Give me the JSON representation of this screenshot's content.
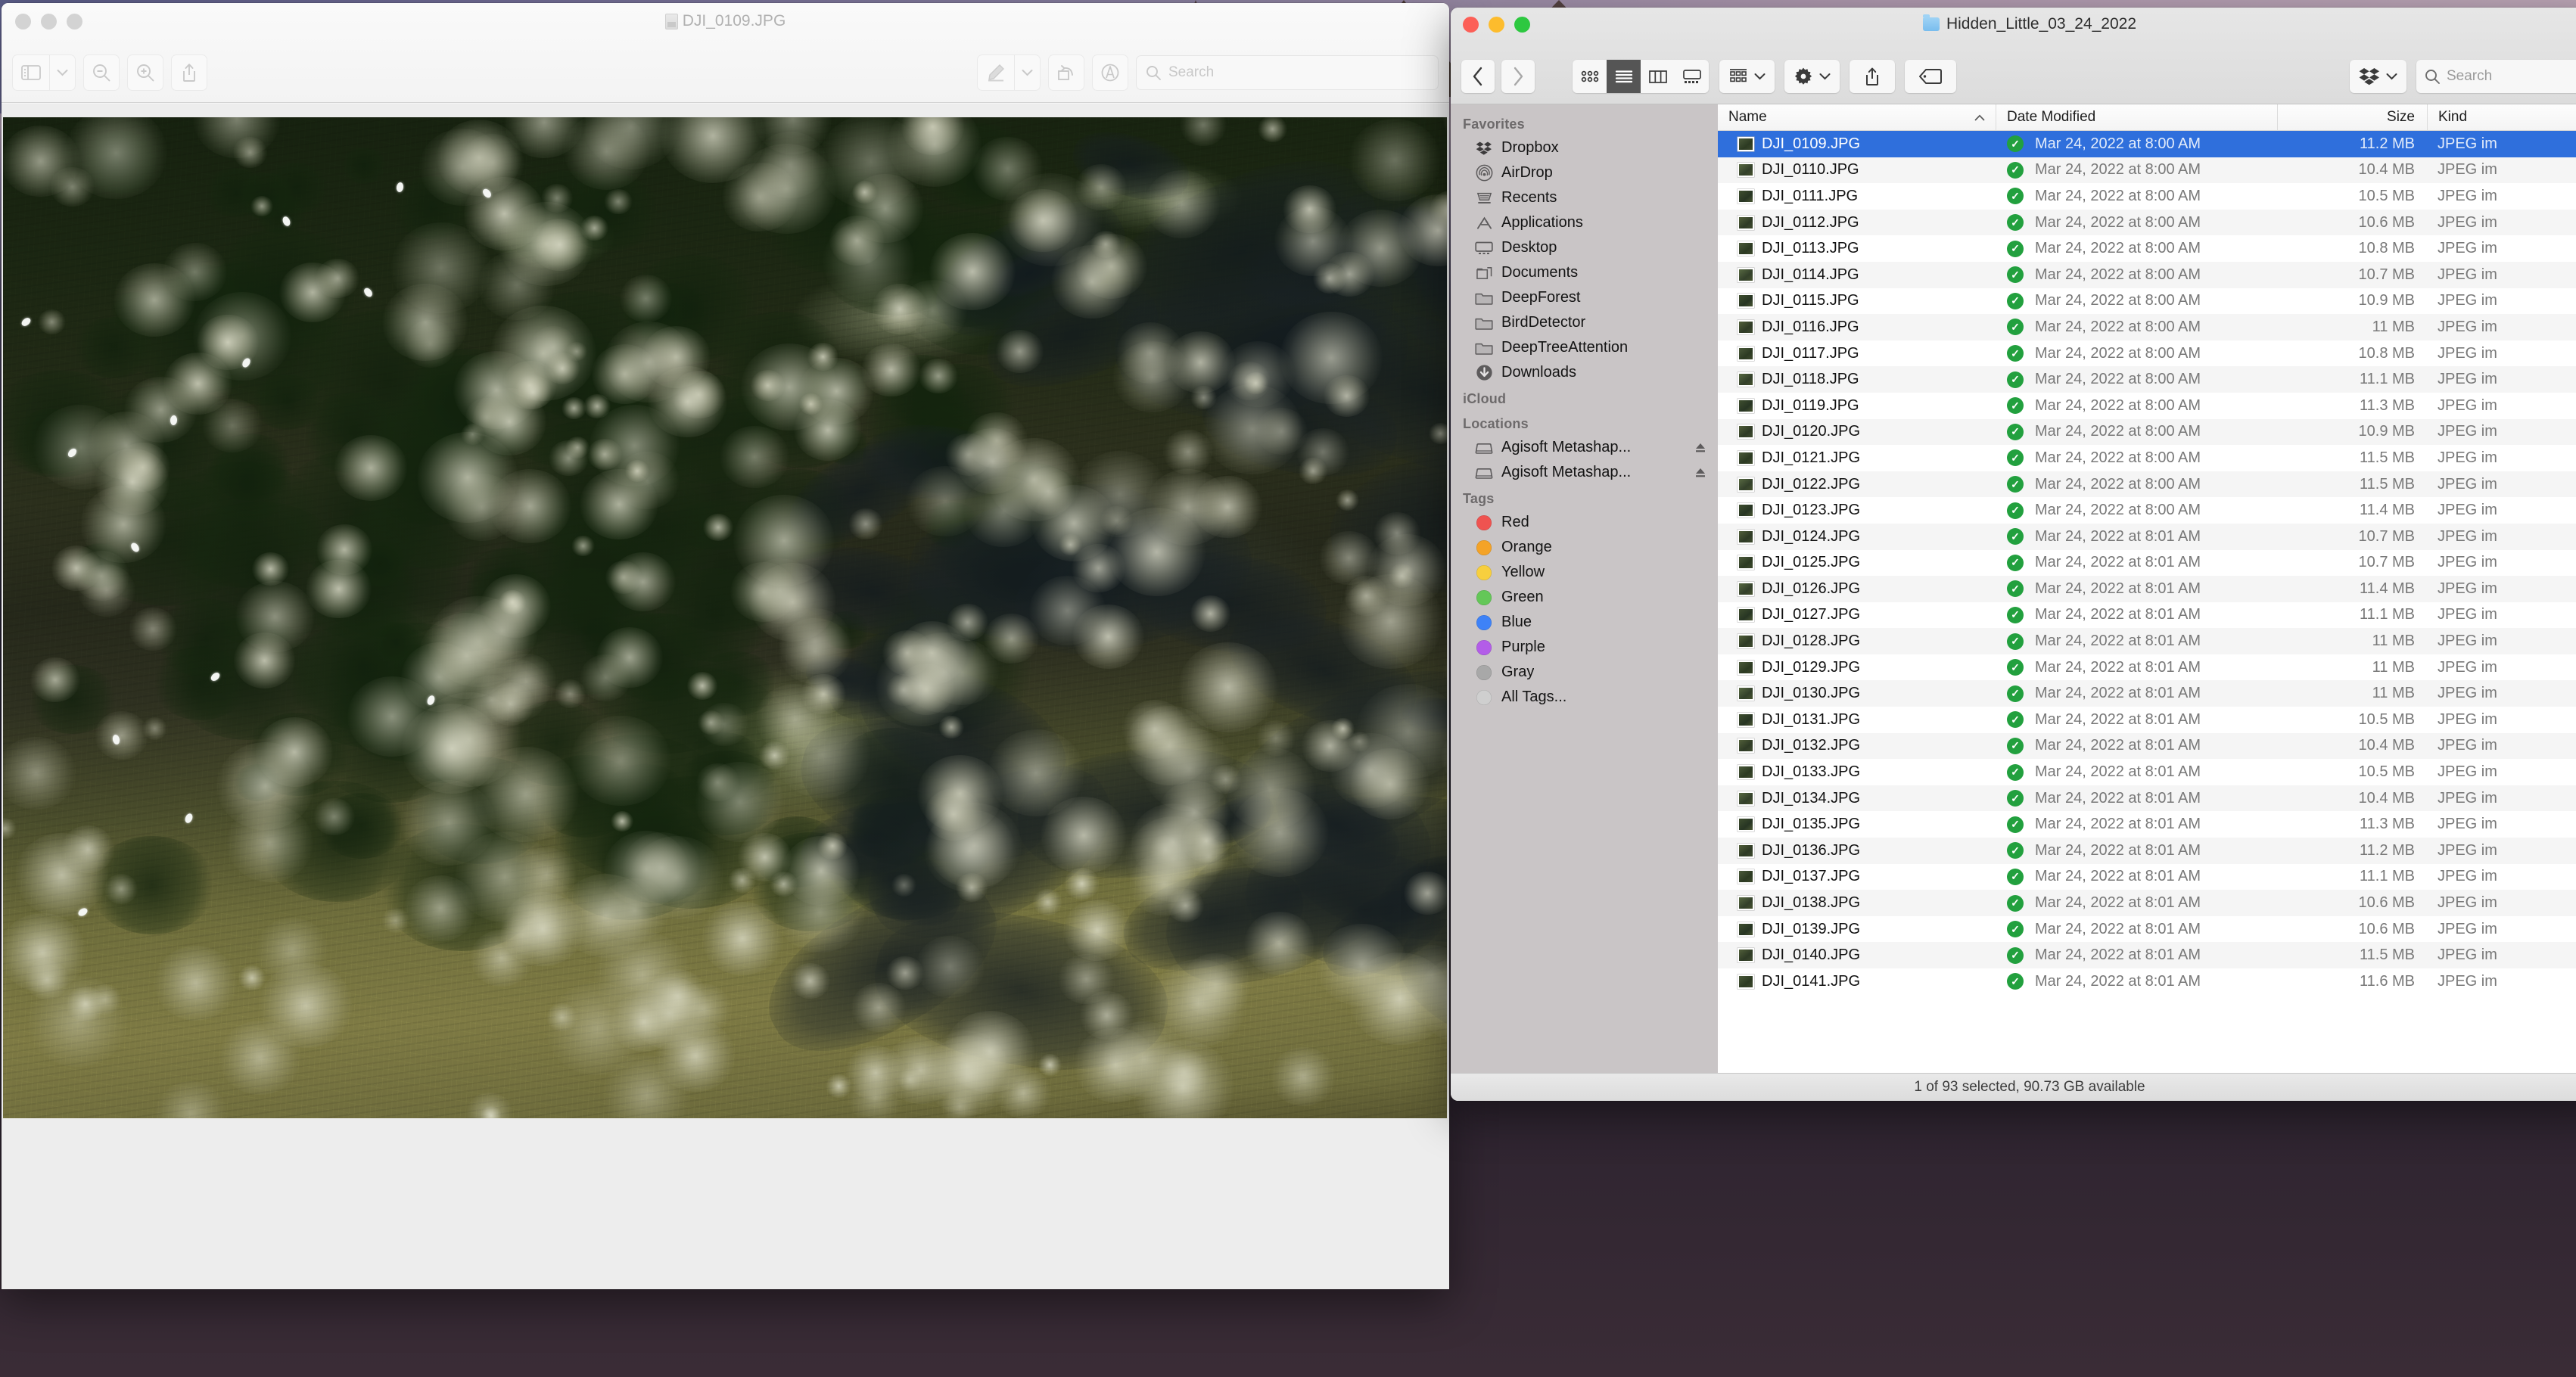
{
  "desktop": {
    "wallpaper_description": "purple mountain sunset wallpaper"
  },
  "preview_window": {
    "title": "DJI_0109.JPG",
    "doc_icon": "image-document-icon",
    "active": false,
    "traffic_lights": [
      "close-button",
      "minimize-button",
      "zoom-button"
    ],
    "toolbar": {
      "sidebar_toggle": "sidebar-icon",
      "sidebar_dropdown": "chevron-down-icon",
      "zoom_out": "zoom-out-icon",
      "zoom_in": "zoom-in-icon",
      "share": "share-icon",
      "markup": "markup-pen-icon",
      "markup_dropdown": "chevron-down-icon",
      "rotate": "rotate-left-icon",
      "annotate": "annotate-icon"
    },
    "search": {
      "placeholder": "Search",
      "value": ""
    }
  },
  "finder_window": {
    "title": "Hidden_Little_03_24_2022",
    "folder_icon": "folder-icon",
    "active": true,
    "traffic_lights": [
      "close-button",
      "minimize-button",
      "zoom-button"
    ],
    "toolbar": {
      "back": "‹",
      "forward": "›",
      "views": [
        {
          "name": "icon-view",
          "icon": "grid-icon",
          "active": false
        },
        {
          "name": "list-view",
          "icon": "list-icon",
          "active": true
        },
        {
          "name": "column-view",
          "icon": "columns-icon",
          "active": false
        },
        {
          "name": "gallery-view",
          "icon": "gallery-icon",
          "active": false
        }
      ],
      "group_by": "group-icon",
      "group_by_dropdown": "chevron-down-icon",
      "action": "gear-icon",
      "action_dropdown": "chevron-down-icon",
      "share": "share-icon",
      "tags": "tag-icon",
      "dropbox": "dropbox-icon",
      "dropbox_dropdown": "chevron-down-icon"
    },
    "search": {
      "placeholder": "Search",
      "value": ""
    },
    "sidebar": {
      "sections": [
        {
          "label": "Favorites",
          "items": [
            {
              "label": "Dropbox",
              "icon": "dropbox-icon"
            },
            {
              "label": "AirDrop",
              "icon": "airdrop-icon"
            },
            {
              "label": "Recents",
              "icon": "recents-icon"
            },
            {
              "label": "Applications",
              "icon": "applications-icon"
            },
            {
              "label": "Desktop",
              "icon": "desktop-icon"
            },
            {
              "label": "Documents",
              "icon": "documents-icon"
            },
            {
              "label": "DeepForest",
              "icon": "folder-icon"
            },
            {
              "label": "BirdDetector",
              "icon": "folder-icon"
            },
            {
              "label": "DeepTreeAttention",
              "icon": "folder-icon"
            },
            {
              "label": "Downloads",
              "icon": "downloads-icon"
            }
          ]
        },
        {
          "label": "iCloud",
          "items": []
        },
        {
          "label": "Locations",
          "items": [
            {
              "label": "Agisoft Metashap...",
              "icon": "disk-icon",
              "eject": true
            },
            {
              "label": "Agisoft Metashap...",
              "icon": "disk-icon",
              "eject": true
            }
          ]
        },
        {
          "label": "Tags",
          "items": [
            {
              "label": "Red",
              "color": "#ef5350"
            },
            {
              "label": "Orange",
              "color": "#f4a327"
            },
            {
              "label": "Yellow",
              "color": "#f7cf3e"
            },
            {
              "label": "Green",
              "color": "#64c758"
            },
            {
              "label": "Blue",
              "color": "#3e82f7"
            },
            {
              "label": "Purple",
              "color": "#b35de8"
            },
            {
              "label": "Gray",
              "color": "#a8a8a8"
            },
            {
              "label": "All Tags...",
              "color": "#cfcfcf"
            }
          ]
        }
      ]
    },
    "list": {
      "columns": [
        {
          "key": "name",
          "label": "Name",
          "sorted": true,
          "sort_icon": "chevron-up-icon"
        },
        {
          "key": "date",
          "label": "Date Modified"
        },
        {
          "key": "size",
          "label": "Size"
        },
        {
          "key": "kind",
          "label": "Kind"
        }
      ],
      "rows": [
        {
          "name": "DJI_0109.JPG",
          "date": "Mar 24, 2022 at 8:00 AM",
          "size": "11.2 MB",
          "kind": "JPEG im",
          "synced": true,
          "selected": true
        },
        {
          "name": "DJI_0110.JPG",
          "date": "Mar 24, 2022 at 8:00 AM",
          "size": "10.4 MB",
          "kind": "JPEG im",
          "synced": true,
          "selected": false
        },
        {
          "name": "DJI_0111.JPG",
          "date": "Mar 24, 2022 at 8:00 AM",
          "size": "10.5 MB",
          "kind": "JPEG im",
          "synced": true,
          "selected": false
        },
        {
          "name": "DJI_0112.JPG",
          "date": "Mar 24, 2022 at 8:00 AM",
          "size": "10.6 MB",
          "kind": "JPEG im",
          "synced": true,
          "selected": false
        },
        {
          "name": "DJI_0113.JPG",
          "date": "Mar 24, 2022 at 8:00 AM",
          "size": "10.8 MB",
          "kind": "JPEG im",
          "synced": true,
          "selected": false
        },
        {
          "name": "DJI_0114.JPG",
          "date": "Mar 24, 2022 at 8:00 AM",
          "size": "10.7 MB",
          "kind": "JPEG im",
          "synced": true,
          "selected": false
        },
        {
          "name": "DJI_0115.JPG",
          "date": "Mar 24, 2022 at 8:00 AM",
          "size": "10.9 MB",
          "kind": "JPEG im",
          "synced": true,
          "selected": false
        },
        {
          "name": "DJI_0116.JPG",
          "date": "Mar 24, 2022 at 8:00 AM",
          "size": "11 MB",
          "kind": "JPEG im",
          "synced": true,
          "selected": false
        },
        {
          "name": "DJI_0117.JPG",
          "date": "Mar 24, 2022 at 8:00 AM",
          "size": "10.8 MB",
          "kind": "JPEG im",
          "synced": true,
          "selected": false
        },
        {
          "name": "DJI_0118.JPG",
          "date": "Mar 24, 2022 at 8:00 AM",
          "size": "11.1 MB",
          "kind": "JPEG im",
          "synced": true,
          "selected": false
        },
        {
          "name": "DJI_0119.JPG",
          "date": "Mar 24, 2022 at 8:00 AM",
          "size": "11.3 MB",
          "kind": "JPEG im",
          "synced": true,
          "selected": false
        },
        {
          "name": "DJI_0120.JPG",
          "date": "Mar 24, 2022 at 8:00 AM",
          "size": "10.9 MB",
          "kind": "JPEG im",
          "synced": true,
          "selected": false
        },
        {
          "name": "DJI_0121.JPG",
          "date": "Mar 24, 2022 at 8:00 AM",
          "size": "11.5 MB",
          "kind": "JPEG im",
          "synced": true,
          "selected": false
        },
        {
          "name": "DJI_0122.JPG",
          "date": "Mar 24, 2022 at 8:00 AM",
          "size": "11.5 MB",
          "kind": "JPEG im",
          "synced": true,
          "selected": false
        },
        {
          "name": "DJI_0123.JPG",
          "date": "Mar 24, 2022 at 8:00 AM",
          "size": "11.4 MB",
          "kind": "JPEG im",
          "synced": true,
          "selected": false
        },
        {
          "name": "DJI_0124.JPG",
          "date": "Mar 24, 2022 at 8:01 AM",
          "size": "10.7 MB",
          "kind": "JPEG im",
          "synced": true,
          "selected": false
        },
        {
          "name": "DJI_0125.JPG",
          "date": "Mar 24, 2022 at 8:01 AM",
          "size": "10.7 MB",
          "kind": "JPEG im",
          "synced": true,
          "selected": false
        },
        {
          "name": "DJI_0126.JPG",
          "date": "Mar 24, 2022 at 8:01 AM",
          "size": "11.4 MB",
          "kind": "JPEG im",
          "synced": true,
          "selected": false
        },
        {
          "name": "DJI_0127.JPG",
          "date": "Mar 24, 2022 at 8:01 AM",
          "size": "11.1 MB",
          "kind": "JPEG im",
          "synced": true,
          "selected": false
        },
        {
          "name": "DJI_0128.JPG",
          "date": "Mar 24, 2022 at 8:01 AM",
          "size": "11 MB",
          "kind": "JPEG im",
          "synced": true,
          "selected": false
        },
        {
          "name": "DJI_0129.JPG",
          "date": "Mar 24, 2022 at 8:01 AM",
          "size": "11 MB",
          "kind": "JPEG im",
          "synced": true,
          "selected": false
        },
        {
          "name": "DJI_0130.JPG",
          "date": "Mar 24, 2022 at 8:01 AM",
          "size": "11 MB",
          "kind": "JPEG im",
          "synced": true,
          "selected": false
        },
        {
          "name": "DJI_0131.JPG",
          "date": "Mar 24, 2022 at 8:01 AM",
          "size": "10.5 MB",
          "kind": "JPEG im",
          "synced": true,
          "selected": false
        },
        {
          "name": "DJI_0132.JPG",
          "date": "Mar 24, 2022 at 8:01 AM",
          "size": "10.4 MB",
          "kind": "JPEG im",
          "synced": true,
          "selected": false
        },
        {
          "name": "DJI_0133.JPG",
          "date": "Mar 24, 2022 at 8:01 AM",
          "size": "10.5 MB",
          "kind": "JPEG im",
          "synced": true,
          "selected": false
        },
        {
          "name": "DJI_0134.JPG",
          "date": "Mar 24, 2022 at 8:01 AM",
          "size": "10.4 MB",
          "kind": "JPEG im",
          "synced": true,
          "selected": false
        },
        {
          "name": "DJI_0135.JPG",
          "date": "Mar 24, 2022 at 8:01 AM",
          "size": "11.3 MB",
          "kind": "JPEG im",
          "synced": true,
          "selected": false
        },
        {
          "name": "DJI_0136.JPG",
          "date": "Mar 24, 2022 at 8:01 AM",
          "size": "11.2 MB",
          "kind": "JPEG im",
          "synced": true,
          "selected": false
        },
        {
          "name": "DJI_0137.JPG",
          "date": "Mar 24, 2022 at 8:01 AM",
          "size": "11.1 MB",
          "kind": "JPEG im",
          "synced": true,
          "selected": false
        },
        {
          "name": "DJI_0138.JPG",
          "date": "Mar 24, 2022 at 8:01 AM",
          "size": "10.6 MB",
          "kind": "JPEG im",
          "synced": true,
          "selected": false
        },
        {
          "name": "DJI_0139.JPG",
          "date": "Mar 24, 2022 at 8:01 AM",
          "size": "10.6 MB",
          "kind": "JPEG im",
          "synced": true,
          "selected": false
        },
        {
          "name": "DJI_0140.JPG",
          "date": "Mar 24, 2022 at 8:01 AM",
          "size": "11.5 MB",
          "kind": "JPEG im",
          "synced": true,
          "selected": false
        },
        {
          "name": "DJI_0141.JPG",
          "date": "Mar 24, 2022 at 8:01 AM",
          "size": "11.6 MB",
          "kind": "JPEG im",
          "synced": true,
          "selected": false
        }
      ]
    },
    "status": "1 of 93 selected, 90.73 GB available"
  },
  "colors": {
    "selection_blue": "#2f6fdc",
    "sync_green": "#22a03e",
    "sidebar_bg": "#c9c5c6"
  }
}
